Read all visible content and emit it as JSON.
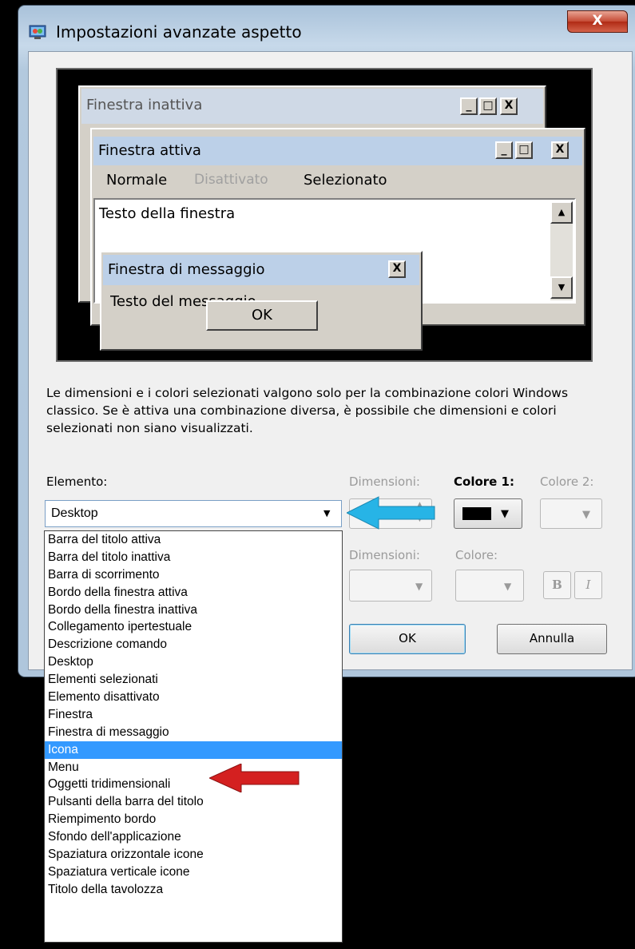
{
  "window": {
    "title": "Impostazioni avanzate aspetto",
    "close_label": "X"
  },
  "preview": {
    "inactive_title": "Finestra inattiva",
    "active_title": "Finestra attiva",
    "menu_normal": "Normale",
    "menu_disabled": "Disattivato",
    "menu_selected": "Selezionato",
    "window_text": "Testo della finestra",
    "msgbox_title": "Finestra di messaggio",
    "msgbox_text": "Testo del messaggio",
    "msgbox_ok": "OK",
    "cap_min": "_",
    "cap_max": "□",
    "cap_close": "X",
    "scroll_up": "▲",
    "scroll_down": "▼"
  },
  "info_text": "Le dimensioni e i colori selezionati valgono solo per la combinazione colori Windows classico. Se è attiva una combinazione diversa, è possibile che dimensioni e colori selezionati non siano visualizzati.",
  "labels": {
    "element": "Elemento:",
    "size": "Dimensioni:",
    "color1": "Colore 1:",
    "color2": "Colore 2:",
    "font_size": "Dimensioni:",
    "font_color": "Colore:",
    "bold": "B",
    "italic": "I"
  },
  "element_select": {
    "value": "Desktop",
    "options": [
      "Barra del titolo attiva",
      "Barra del titolo inattiva",
      "Barra di scorrimento",
      "Bordo della finestra attiva",
      "Bordo della finestra inattiva",
      "Collegamento ipertestuale",
      "Descrizione comando",
      "Desktop",
      "Elementi selezionati",
      "Elemento disattivato",
      "Finestra",
      "Finestra di messaggio",
      "Icona",
      "Menu",
      "Oggetti tridimensionali",
      "Pulsanti della barra del titolo",
      "Riempimento bordo",
      "Sfondo dell'applicazione",
      "Spaziatura orizzontale icone",
      "Spaziatura verticale icone",
      "Titolo della tavolozza"
    ],
    "highlighted": "Icona"
  },
  "buttons": {
    "ok": "OK",
    "cancel": "Annulla"
  },
  "colors": {
    "color1_swatch": "#000000",
    "highlight": "#3399ff",
    "arrow_blue": "#27b4e6",
    "arrow_red": "#d42020"
  }
}
